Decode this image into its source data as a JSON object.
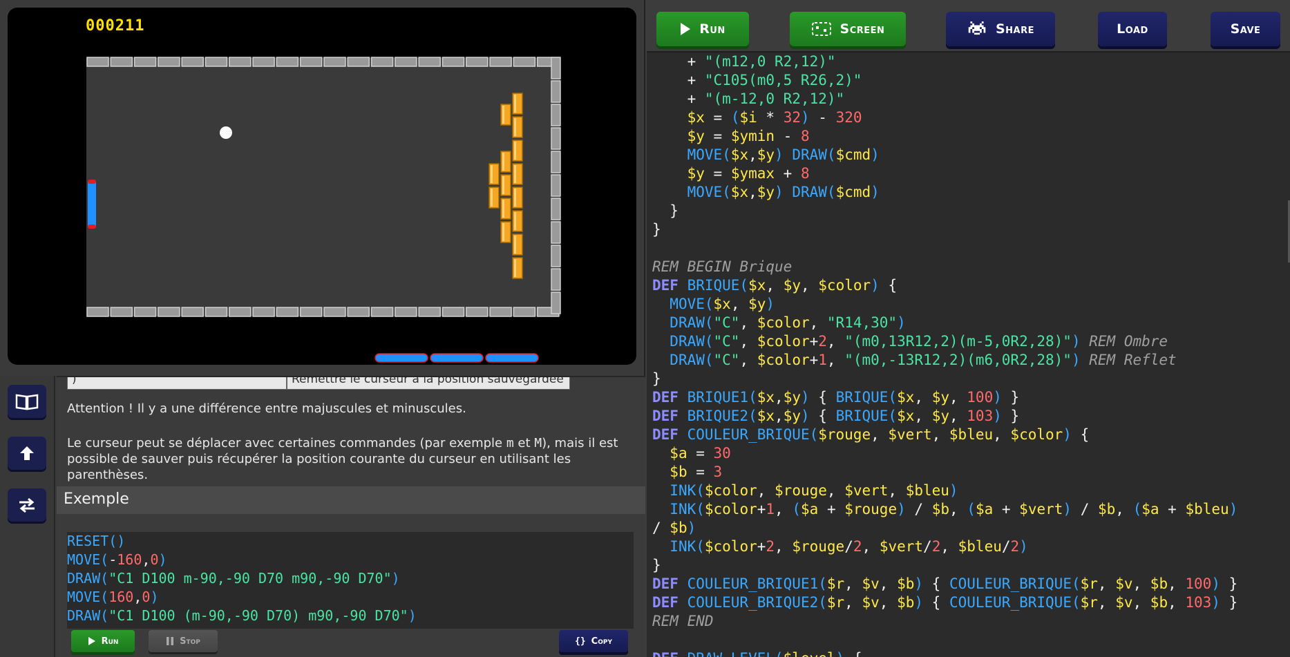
{
  "game": {
    "score": "000211"
  },
  "sidebar": {
    "buttons": [
      {
        "name": "book-icon"
      },
      {
        "name": "upload-icon"
      },
      {
        "name": "swap-icon"
      }
    ]
  },
  "doc": {
    "table_row": {
      "col1": ")",
      "col2": "Remettre le curseur à la position sauvegardée"
    },
    "attention": "Attention ! Il y a une différence entre majuscules et minuscules.",
    "para2_a": "Le curseur peut se déplacer avec certaines commandes (par exemple ",
    "para2_m1": "m",
    "para2_and": " et ",
    "para2_m2": "M",
    "para2_b": "), mais il est",
    "para2_c": "possible de sauver puis récupérer la position courante du curseur en utilisant les parenthèses.",
    "example_title": "Exemple",
    "example_lines": [
      [
        {
          "t": "RESET()",
          "c": "f"
        }
      ],
      [
        {
          "t": "MOVE(",
          "c": "f"
        },
        {
          "t": "-",
          "c": "w"
        },
        {
          "t": "160",
          "c": "n"
        },
        {
          "t": ",",
          "c": "w"
        },
        {
          "t": "0",
          "c": "n"
        },
        {
          "t": ")",
          "c": "f"
        }
      ],
      [
        {
          "t": "DRAW(",
          "c": "f"
        },
        {
          "t": "\"C1 D100 m-90,-90 D70 m90,-90 D70\"",
          "c": "s"
        },
        {
          "t": ")",
          "c": "f"
        }
      ],
      [
        {
          "t": "MOVE(",
          "c": "f"
        },
        {
          "t": "160",
          "c": "n"
        },
        {
          "t": ",",
          "c": "w"
        },
        {
          "t": "0",
          "c": "n"
        },
        {
          "t": ")",
          "c": "f"
        }
      ],
      [
        {
          "t": "DRAW(",
          "c": "f"
        },
        {
          "t": "\"C1 D100 (m-90,-90 D70) m90,-90 D70\"",
          "c": "s"
        },
        {
          "t": ")",
          "c": "f"
        }
      ]
    ],
    "run_label": "Run",
    "stop_label": "Stop",
    "copy_label": "Copy"
  },
  "toolbar": {
    "run_label": "Run",
    "screen_label": "Screen",
    "share_label": "Share",
    "load_label": "Load",
    "save_label": "Save"
  },
  "colors": {
    "green_button": "#1c7a1c",
    "blue_button": "#161b52",
    "keyword": "#8d8dff",
    "function": "#3ba9ff",
    "variable": "#ffe94a",
    "string": "#4ae5a5",
    "number": "#ff6b6b",
    "comment": "#a0a0a0",
    "score": "#ffe100",
    "brick": "#f5a623",
    "paddle": "#1e90ff"
  },
  "editor_lines": [
    [
      {
        "t": "    + ",
        "c": "w"
      },
      {
        "t": "\"(m12,0 R2,12)\"",
        "c": "s"
      }
    ],
    [
      {
        "t": "    + ",
        "c": "w"
      },
      {
        "t": "\"C105(m0,5 R26,2)\"",
        "c": "s"
      }
    ],
    [
      {
        "t": "    + ",
        "c": "w"
      },
      {
        "t": "\"(m-12,0 R2,12)\"",
        "c": "s"
      }
    ],
    [
      {
        "t": "    ",
        "c": "w"
      },
      {
        "t": "$x",
        "c": "v"
      },
      {
        "t": " = ",
        "c": "w"
      },
      {
        "t": "(",
        "c": "f"
      },
      {
        "t": "$i",
        "c": "v"
      },
      {
        "t": " * ",
        "c": "w"
      },
      {
        "t": "32",
        "c": "n"
      },
      {
        "t": ")",
        "c": "f"
      },
      {
        "t": " - ",
        "c": "w"
      },
      {
        "t": "320",
        "c": "n"
      }
    ],
    [
      {
        "t": "    ",
        "c": "w"
      },
      {
        "t": "$y",
        "c": "v"
      },
      {
        "t": " = ",
        "c": "w"
      },
      {
        "t": "$ymin",
        "c": "v"
      },
      {
        "t": " - ",
        "c": "w"
      },
      {
        "t": "8",
        "c": "n"
      }
    ],
    [
      {
        "t": "    ",
        "c": "w"
      },
      {
        "t": "MOVE(",
        "c": "f"
      },
      {
        "t": "$x",
        "c": "v"
      },
      {
        "t": ",",
        "c": "w"
      },
      {
        "t": "$y",
        "c": "v"
      },
      {
        "t": ") ",
        "c": "f"
      },
      {
        "t": "DRAW(",
        "c": "f"
      },
      {
        "t": "$cmd",
        "c": "v"
      },
      {
        "t": ")",
        "c": "f"
      }
    ],
    [
      {
        "t": "    ",
        "c": "w"
      },
      {
        "t": "$y",
        "c": "v"
      },
      {
        "t": " = ",
        "c": "w"
      },
      {
        "t": "$ymax",
        "c": "v"
      },
      {
        "t": " + ",
        "c": "w"
      },
      {
        "t": "8",
        "c": "n"
      }
    ],
    [
      {
        "t": "    ",
        "c": "w"
      },
      {
        "t": "MOVE(",
        "c": "f"
      },
      {
        "t": "$x",
        "c": "v"
      },
      {
        "t": ",",
        "c": "w"
      },
      {
        "t": "$y",
        "c": "v"
      },
      {
        "t": ") ",
        "c": "f"
      },
      {
        "t": "DRAW(",
        "c": "f"
      },
      {
        "t": "$cmd",
        "c": "v"
      },
      {
        "t": ")",
        "c": "f"
      }
    ],
    [
      {
        "t": "  }",
        "c": "w"
      }
    ],
    [
      {
        "t": "}",
        "c": "w"
      }
    ],
    [],
    [
      {
        "t": "REM BEGIN Brique",
        "c": "c"
      }
    ],
    [
      {
        "t": "DEF ",
        "c": "k"
      },
      {
        "t": "BRIQUE(",
        "c": "f"
      },
      {
        "t": "$x",
        "c": "v"
      },
      {
        "t": ", ",
        "c": "w"
      },
      {
        "t": "$y",
        "c": "v"
      },
      {
        "t": ", ",
        "c": "w"
      },
      {
        "t": "$color",
        "c": "v"
      },
      {
        "t": ")",
        "c": "f"
      },
      {
        "t": " {",
        "c": "w"
      }
    ],
    [
      {
        "t": "  ",
        "c": "w"
      },
      {
        "t": "MOVE(",
        "c": "f"
      },
      {
        "t": "$x",
        "c": "v"
      },
      {
        "t": ", ",
        "c": "w"
      },
      {
        "t": "$y",
        "c": "v"
      },
      {
        "t": ")",
        "c": "f"
      }
    ],
    [
      {
        "t": "  ",
        "c": "w"
      },
      {
        "t": "DRAW(",
        "c": "f"
      },
      {
        "t": "\"C\"",
        "c": "s"
      },
      {
        "t": ", ",
        "c": "w"
      },
      {
        "t": "$color",
        "c": "v"
      },
      {
        "t": ", ",
        "c": "w"
      },
      {
        "t": "\"R14,30\"",
        "c": "s"
      },
      {
        "t": ")",
        "c": "f"
      }
    ],
    [
      {
        "t": "  ",
        "c": "w"
      },
      {
        "t": "DRAW(",
        "c": "f"
      },
      {
        "t": "\"C\"",
        "c": "s"
      },
      {
        "t": ", ",
        "c": "w"
      },
      {
        "t": "$color",
        "c": "v"
      },
      {
        "t": "+",
        "c": "w"
      },
      {
        "t": "2",
        "c": "n"
      },
      {
        "t": ", ",
        "c": "w"
      },
      {
        "t": "\"(m0,13R12,2)(m-5,0R2,28)\"",
        "c": "s"
      },
      {
        "t": ") ",
        "c": "f"
      },
      {
        "t": "REM Ombre",
        "c": "c"
      }
    ],
    [
      {
        "t": "  ",
        "c": "w"
      },
      {
        "t": "DRAW(",
        "c": "f"
      },
      {
        "t": "\"C\"",
        "c": "s"
      },
      {
        "t": ", ",
        "c": "w"
      },
      {
        "t": "$color",
        "c": "v"
      },
      {
        "t": "+",
        "c": "w"
      },
      {
        "t": "1",
        "c": "n"
      },
      {
        "t": ", ",
        "c": "w"
      },
      {
        "t": "\"(m0,-13R12,2)(m6,0R2,28)\"",
        "c": "s"
      },
      {
        "t": ") ",
        "c": "f"
      },
      {
        "t": "REM Reflet",
        "c": "c"
      }
    ],
    [
      {
        "t": "}",
        "c": "w"
      }
    ],
    [
      {
        "t": "DEF ",
        "c": "k"
      },
      {
        "t": "BRIQUE1(",
        "c": "f"
      },
      {
        "t": "$x",
        "c": "v"
      },
      {
        "t": ",",
        "c": "w"
      },
      {
        "t": "$y",
        "c": "v"
      },
      {
        "t": ")",
        "c": "f"
      },
      {
        "t": " { ",
        "c": "w"
      },
      {
        "t": "BRIQUE(",
        "c": "f"
      },
      {
        "t": "$x",
        "c": "v"
      },
      {
        "t": ", ",
        "c": "w"
      },
      {
        "t": "$y",
        "c": "v"
      },
      {
        "t": ", ",
        "c": "w"
      },
      {
        "t": "100",
        "c": "n"
      },
      {
        "t": ")",
        "c": "f"
      },
      {
        "t": " }",
        "c": "w"
      }
    ],
    [
      {
        "t": "DEF ",
        "c": "k"
      },
      {
        "t": "BRIQUE2(",
        "c": "f"
      },
      {
        "t": "$x",
        "c": "v"
      },
      {
        "t": ",",
        "c": "w"
      },
      {
        "t": "$y",
        "c": "v"
      },
      {
        "t": ")",
        "c": "f"
      },
      {
        "t": " { ",
        "c": "w"
      },
      {
        "t": "BRIQUE(",
        "c": "f"
      },
      {
        "t": "$x",
        "c": "v"
      },
      {
        "t": ", ",
        "c": "w"
      },
      {
        "t": "$y",
        "c": "v"
      },
      {
        "t": ", ",
        "c": "w"
      },
      {
        "t": "103",
        "c": "n"
      },
      {
        "t": ")",
        "c": "f"
      },
      {
        "t": " }",
        "c": "w"
      }
    ],
    [
      {
        "t": "DEF ",
        "c": "k"
      },
      {
        "t": "COULEUR_BRIQUE(",
        "c": "f"
      },
      {
        "t": "$rouge",
        "c": "v"
      },
      {
        "t": ", ",
        "c": "w"
      },
      {
        "t": "$vert",
        "c": "v"
      },
      {
        "t": ", ",
        "c": "w"
      },
      {
        "t": "$bleu",
        "c": "v"
      },
      {
        "t": ", ",
        "c": "w"
      },
      {
        "t": "$color",
        "c": "v"
      },
      {
        "t": ")",
        "c": "f"
      },
      {
        "t": " {",
        "c": "w"
      }
    ],
    [
      {
        "t": "  ",
        "c": "w"
      },
      {
        "t": "$a",
        "c": "v"
      },
      {
        "t": " = ",
        "c": "w"
      },
      {
        "t": "30",
        "c": "n"
      }
    ],
    [
      {
        "t": "  ",
        "c": "w"
      },
      {
        "t": "$b",
        "c": "v"
      },
      {
        "t": " = ",
        "c": "w"
      },
      {
        "t": "3",
        "c": "n"
      }
    ],
    [
      {
        "t": "  ",
        "c": "w"
      },
      {
        "t": "INK(",
        "c": "f"
      },
      {
        "t": "$color",
        "c": "v"
      },
      {
        "t": ", ",
        "c": "w"
      },
      {
        "t": "$rouge",
        "c": "v"
      },
      {
        "t": ", ",
        "c": "w"
      },
      {
        "t": "$vert",
        "c": "v"
      },
      {
        "t": ", ",
        "c": "w"
      },
      {
        "t": "$bleu",
        "c": "v"
      },
      {
        "t": ")",
        "c": "f"
      }
    ],
    [
      {
        "t": "  ",
        "c": "w"
      },
      {
        "t": "INK(",
        "c": "f"
      },
      {
        "t": "$color",
        "c": "v"
      },
      {
        "t": "+",
        "c": "w"
      },
      {
        "t": "1",
        "c": "n"
      },
      {
        "t": ", ",
        "c": "w"
      },
      {
        "t": "(",
        "c": "f"
      },
      {
        "t": "$a",
        "c": "v"
      },
      {
        "t": " + ",
        "c": "w"
      },
      {
        "t": "$rouge",
        "c": "v"
      },
      {
        "t": ")",
        "c": "f"
      },
      {
        "t": " / ",
        "c": "w"
      },
      {
        "t": "$b",
        "c": "v"
      },
      {
        "t": ", ",
        "c": "w"
      },
      {
        "t": "(",
        "c": "f"
      },
      {
        "t": "$a",
        "c": "v"
      },
      {
        "t": " + ",
        "c": "w"
      },
      {
        "t": "$vert",
        "c": "v"
      },
      {
        "t": ")",
        "c": "f"
      },
      {
        "t": " / ",
        "c": "w"
      },
      {
        "t": "$b",
        "c": "v"
      },
      {
        "t": ", ",
        "c": "w"
      },
      {
        "t": "(",
        "c": "f"
      },
      {
        "t": "$a",
        "c": "v"
      },
      {
        "t": " + ",
        "c": "w"
      },
      {
        "t": "$bleu",
        "c": "v"
      },
      {
        "t": ")",
        "c": "f"
      }
    ],
    [
      {
        "t": "/ ",
        "c": "w"
      },
      {
        "t": "$b",
        "c": "v"
      },
      {
        "t": ")",
        "c": "f"
      }
    ],
    [
      {
        "t": "  ",
        "c": "w"
      },
      {
        "t": "INK(",
        "c": "f"
      },
      {
        "t": "$color",
        "c": "v"
      },
      {
        "t": "+",
        "c": "w"
      },
      {
        "t": "2",
        "c": "n"
      },
      {
        "t": ", ",
        "c": "w"
      },
      {
        "t": "$rouge",
        "c": "v"
      },
      {
        "t": "/",
        "c": "w"
      },
      {
        "t": "2",
        "c": "n"
      },
      {
        "t": ", ",
        "c": "w"
      },
      {
        "t": "$vert",
        "c": "v"
      },
      {
        "t": "/",
        "c": "w"
      },
      {
        "t": "2",
        "c": "n"
      },
      {
        "t": ", ",
        "c": "w"
      },
      {
        "t": "$bleu",
        "c": "v"
      },
      {
        "t": "/",
        "c": "w"
      },
      {
        "t": "2",
        "c": "n"
      },
      {
        "t": ")",
        "c": "f"
      }
    ],
    [
      {
        "t": "}",
        "c": "w"
      }
    ],
    [
      {
        "t": "DEF ",
        "c": "k"
      },
      {
        "t": "COULEUR_BRIQUE1(",
        "c": "f"
      },
      {
        "t": "$r",
        "c": "v"
      },
      {
        "t": ", ",
        "c": "w"
      },
      {
        "t": "$v",
        "c": "v"
      },
      {
        "t": ", ",
        "c": "w"
      },
      {
        "t": "$b",
        "c": "v"
      },
      {
        "t": ")",
        "c": "f"
      },
      {
        "t": " { ",
        "c": "w"
      },
      {
        "t": "COULEUR_BRIQUE(",
        "c": "f"
      },
      {
        "t": "$r",
        "c": "v"
      },
      {
        "t": ", ",
        "c": "w"
      },
      {
        "t": "$v",
        "c": "v"
      },
      {
        "t": ", ",
        "c": "w"
      },
      {
        "t": "$b",
        "c": "v"
      },
      {
        "t": ", ",
        "c": "w"
      },
      {
        "t": "100",
        "c": "n"
      },
      {
        "t": ")",
        "c": "f"
      },
      {
        "t": " }",
        "c": "w"
      }
    ],
    [
      {
        "t": "DEF ",
        "c": "k"
      },
      {
        "t": "COULEUR_BRIQUE2(",
        "c": "f"
      },
      {
        "t": "$r",
        "c": "v"
      },
      {
        "t": ", ",
        "c": "w"
      },
      {
        "t": "$v",
        "c": "v"
      },
      {
        "t": ", ",
        "c": "w"
      },
      {
        "t": "$b",
        "c": "v"
      },
      {
        "t": ")",
        "c": "f"
      },
      {
        "t": " { ",
        "c": "w"
      },
      {
        "t": "COULEUR_BRIQUE(",
        "c": "f"
      },
      {
        "t": "$r",
        "c": "v"
      },
      {
        "t": ", ",
        "c": "w"
      },
      {
        "t": "$v",
        "c": "v"
      },
      {
        "t": ", ",
        "c": "w"
      },
      {
        "t": "$b",
        "c": "v"
      },
      {
        "t": ", ",
        "c": "w"
      },
      {
        "t": "103",
        "c": "n"
      },
      {
        "t": ")",
        "c": "f"
      },
      {
        "t": " }",
        "c": "w"
      }
    ],
    [
      {
        "t": "REM END",
        "c": "c"
      }
    ],
    [],
    [
      {
        "t": "DEF ",
        "c": "k"
      },
      {
        "t": "DRAW_LEVEL(",
        "c": "f"
      },
      {
        "t": "$level",
        "c": "v"
      },
      {
        "t": ")",
        "c": "f"
      },
      {
        "t": " {",
        "c": "w"
      }
    ]
  ]
}
